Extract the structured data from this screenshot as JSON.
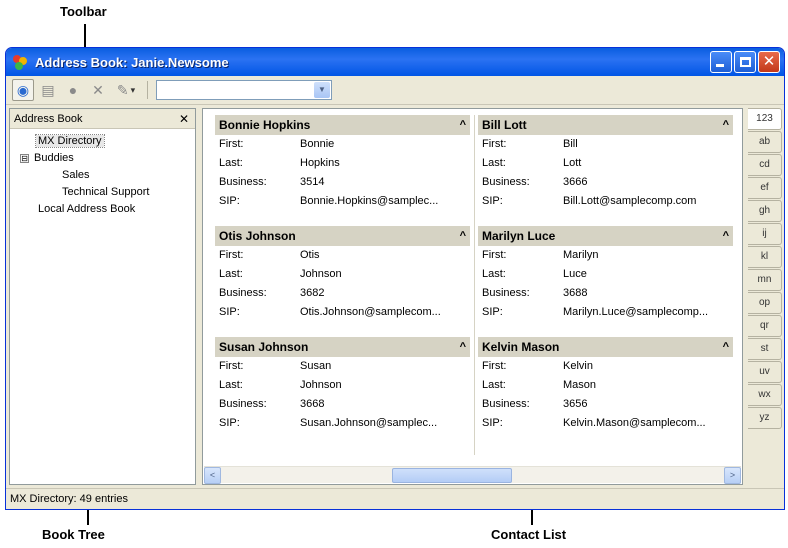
{
  "callouts": {
    "toolbar": "Toolbar",
    "book_tree": "Book Tree",
    "contact_list": "Contact List"
  },
  "window": {
    "title": "Address Book: Janie.Newsome",
    "controls": {
      "minimize": "minimize-icon",
      "maximize": "maximize-icon",
      "close": "close-icon"
    }
  },
  "toolbar": {
    "tools": [
      "address-book-icon",
      "properties-icon",
      "presence-icon",
      "delete-icon",
      "edit-icon"
    ],
    "dropdown_arrow": "▾",
    "search_value": ""
  },
  "tree": {
    "header": "Address Book",
    "close_label": "✕",
    "items": [
      {
        "label": "MX Directory",
        "level": 1,
        "selected": true
      },
      {
        "label": "Buddies",
        "level": 1,
        "expander": "⊟"
      },
      {
        "label": "Sales",
        "level": 2
      },
      {
        "label": "Technical Support",
        "level": 2
      },
      {
        "label": "Local Address Book",
        "level": 1
      }
    ]
  },
  "field_labels": {
    "first": "First:",
    "last": "Last:",
    "business": "Business:",
    "sip": "SIP:"
  },
  "contacts": [
    {
      "name": "Bonnie Hopkins",
      "first": "Bonnie",
      "last": "Hopkins",
      "business": "3514",
      "sip": "Bonnie.Hopkins@samplec..."
    },
    {
      "name": "Otis Johnson",
      "first": "Otis",
      "last": "Johnson",
      "business": "3682",
      "sip": "Otis.Johnson@samplecom..."
    },
    {
      "name": "Susan Johnson",
      "first": "Susan",
      "last": "Johnson",
      "business": "3668",
      "sip": "Susan.Johnson@samplec..."
    },
    {
      "name": "Bill Lott",
      "first": "Bill",
      "last": "Lott",
      "business": "3666",
      "sip": "Bill.Lott@samplecomp.com"
    },
    {
      "name": "Marilyn Luce",
      "first": "Marilyn",
      "last": "Luce",
      "business": "3688",
      "sip": "Marilyn.Luce@samplecomp..."
    },
    {
      "name": "Kelvin Mason",
      "first": "Kelvin",
      "last": "Mason",
      "business": "3656",
      "sip": "Kelvin.Mason@samplecom..."
    }
  ],
  "collapse_glyph": "^",
  "alpha_index": [
    "123",
    "ab",
    "cd",
    "ef",
    "gh",
    "ij",
    "kl",
    "mn",
    "op",
    "qr",
    "st",
    "uv",
    "wx",
    "yz"
  ],
  "scrollbar": {
    "left": "<",
    "right": ">"
  },
  "status": "MX Directory: 49 entries",
  "colors": {
    "title_bar": "#0a5ee0",
    "header_bg": "#d6d3c4",
    "chrome_bg": "#ece9d8"
  }
}
